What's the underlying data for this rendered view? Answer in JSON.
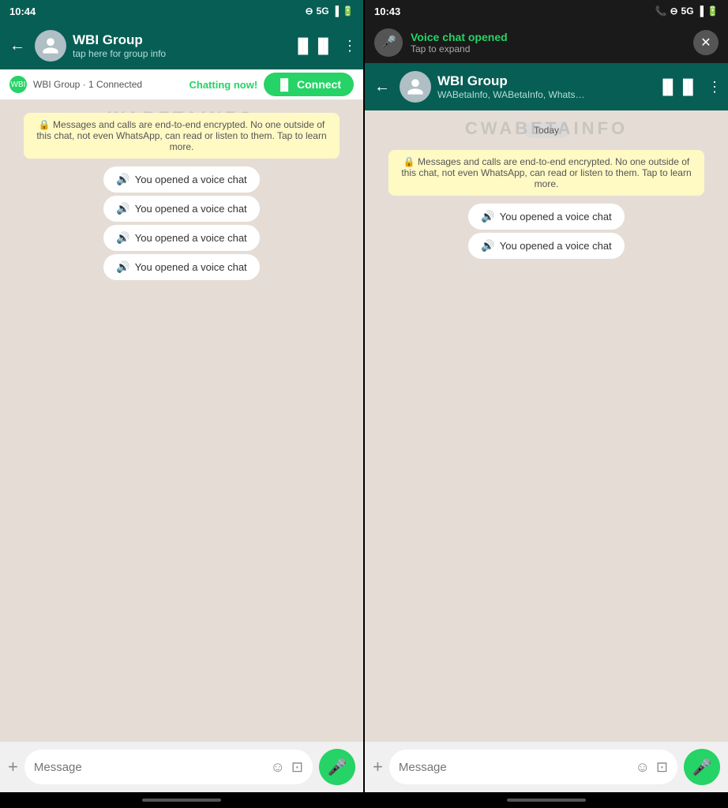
{
  "left": {
    "statusBar": {
      "time": "10:44",
      "signals": "5G",
      "icons": [
        "dnd-icon",
        "signal-icon",
        "battery-icon"
      ]
    },
    "header": {
      "backLabel": "←",
      "groupName": "WBI Group",
      "subtitle": "tap here for group info",
      "icons": [
        "waveform-icon",
        "more-icon"
      ]
    },
    "groupInfoBar": {
      "text": "WBI Group · 1 Connected",
      "chattingLabel": "Chatting now!",
      "connectBtn": "Connect"
    },
    "encryptionNotice": "🔒 Messages and calls are end-to-end encrypted. No one outside of this chat, not even WhatsApp, can read or listen to them. Tap to learn more.",
    "voiceMessages": [
      "You opened a voice chat",
      "You opened a voice chat",
      "You opened a voice chat",
      "You opened a voice chat"
    ],
    "inputBar": {
      "placeholder": "Message",
      "plusIcon": "+",
      "emojiIcon": "😊",
      "cameraIcon": "📷",
      "micIcon": "🎤"
    },
    "watermark": "WABETAINFO"
  },
  "right": {
    "statusBar": {
      "time": "10:43",
      "icons": [
        "phone-icon",
        "dnd-icon",
        "5g-icon",
        "signal-icon",
        "battery-icon"
      ]
    },
    "voiceNotifBar": {
      "title": "Voice chat opened",
      "subtitle": "Tap to expand",
      "closeIcon": "✕"
    },
    "header": {
      "backLabel": "←",
      "groupName": "WBI Group",
      "subtitle": "WABetaInfo, WABetaInfo, Whats…",
      "icons": [
        "waveform-icon",
        "more-icon"
      ]
    },
    "dateChip": "Today",
    "encryptionNotice": "🔒 Messages and calls are end-to-end encrypted. No one outside of this chat, not even WhatsApp, can read or listen to them. Tap to learn more.",
    "voiceMessages": [
      "You opened a voice chat",
      "You opened a voice chat"
    ],
    "inputBar": {
      "placeholder": "Message",
      "plusIcon": "+",
      "emojiIcon": "😊",
      "cameraIcon": "📷",
      "micIcon": "🎤"
    },
    "watermark": "CWABETAINFO"
  }
}
